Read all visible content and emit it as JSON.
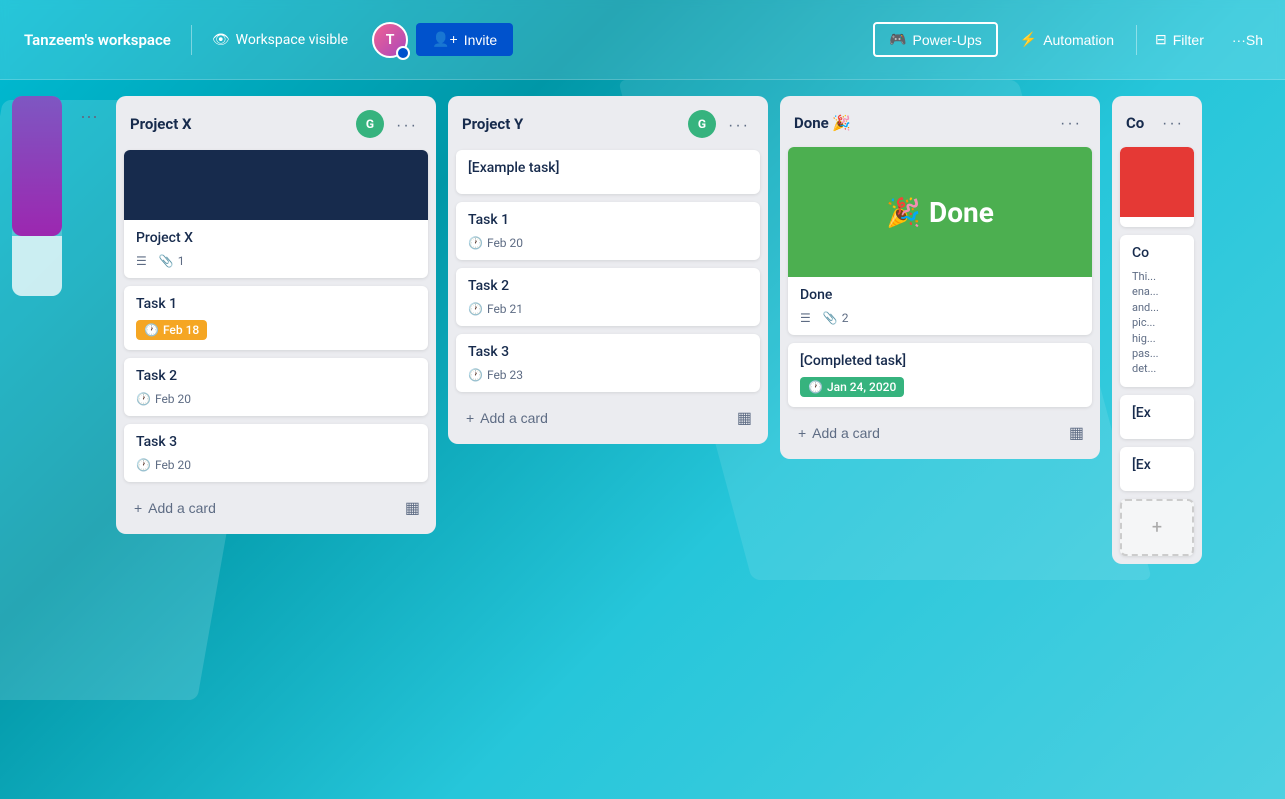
{
  "navbar": {
    "workspace_label": "Tanzeem's workspace",
    "visibility_label": "Workspace visible",
    "invite_label": "Invite",
    "powerups_label": "Power-Ups",
    "automation_label": "Automation",
    "filter_label": "Filter",
    "more_label": "Sh"
  },
  "columns": [
    {
      "id": "project-x",
      "title": "Project X",
      "avatar_initials": "G",
      "cards": [
        {
          "id": "card-px-1",
          "has_cover": true,
          "cover_color": "dark",
          "title": "Project X",
          "meta": [
            {
              "type": "list",
              "icon": "list"
            },
            {
              "type": "attach",
              "icon": "attach",
              "count": "1"
            }
          ]
        },
        {
          "id": "card-px-2",
          "title": "Task 1",
          "meta": [
            {
              "type": "date_badge_yellow",
              "label": "Feb 18"
            }
          ]
        },
        {
          "id": "card-px-3",
          "title": "Task 2",
          "meta": [
            {
              "type": "date",
              "label": "Feb 20"
            }
          ]
        },
        {
          "id": "card-px-4",
          "title": "Task 3",
          "meta": [
            {
              "type": "date",
              "label": "Feb 20"
            }
          ]
        }
      ],
      "add_card_label": "Add a card"
    },
    {
      "id": "project-y",
      "title": "Project Y",
      "avatar_initials": "G",
      "cards": [
        {
          "id": "card-py-0",
          "title": "[Example task]",
          "meta": []
        },
        {
          "id": "card-py-1",
          "title": "Task 1",
          "meta": [
            {
              "type": "date",
              "label": "Feb 20"
            }
          ]
        },
        {
          "id": "card-py-2",
          "title": "Task 2",
          "meta": [
            {
              "type": "date",
              "label": "Feb 21"
            }
          ]
        },
        {
          "id": "card-py-3",
          "title": "Task 3",
          "meta": [
            {
              "type": "date",
              "label": "Feb 23"
            }
          ]
        }
      ],
      "add_card_label": "Add a card"
    },
    {
      "id": "done",
      "title": "Done 🎉",
      "avatar_initials": null,
      "cards": [
        {
          "id": "card-done-1",
          "has_cover": true,
          "cover_color": "green",
          "cover_text": "Done",
          "cover_emoji": "🎉",
          "title": "Done",
          "meta": [
            {
              "type": "list",
              "icon": "list"
            },
            {
              "type": "attach",
              "icon": "attach",
              "count": "2"
            }
          ]
        },
        {
          "id": "card-done-2",
          "title": "[Completed task]",
          "meta": [
            {
              "type": "date_badge_green",
              "label": "Jan 24, 2020"
            }
          ]
        }
      ],
      "add_card_label": "Add a card"
    }
  ],
  "partial_column": {
    "title": "Co",
    "cards": [
      {
        "id": "pc-1",
        "has_cover": true,
        "cover_color": "red"
      },
      {
        "id": "pc-2",
        "title": "Co"
      },
      {
        "id": "pc-3",
        "title": "Thi..."
      },
      {
        "id": "pc-4",
        "title": "[Ex"
      },
      {
        "id": "pc-5",
        "title": "[Ex"
      }
    ]
  }
}
